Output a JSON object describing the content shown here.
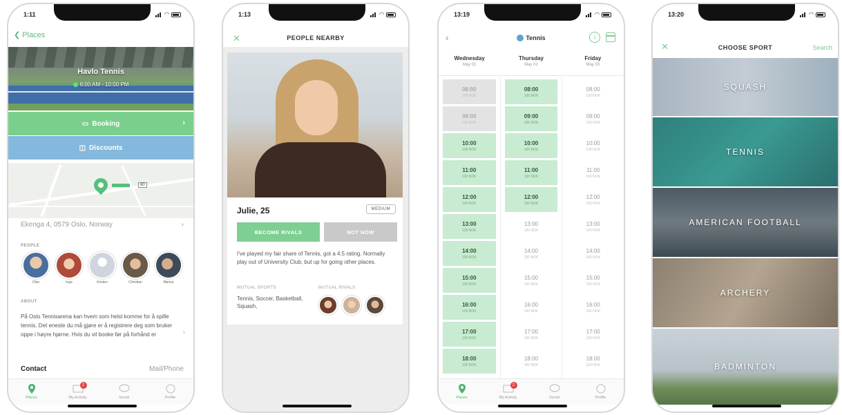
{
  "status_times": [
    "1:11",
    "1:13",
    "13:19",
    "13:20"
  ],
  "phone1": {
    "back_label": "Places",
    "venue_name": "Havlo Tennis",
    "hours": "6:00 AM - 10:00 PM",
    "booking_label": "Booking",
    "discounts_label": "Discounts",
    "address": "Ekenga 4, 0579 Oslo, Norway",
    "people_label": "PEOPLE",
    "people": [
      {
        "name": "Olav",
        "color": "#4a6e9e"
      },
      {
        "name": "Inge",
        "color": "#b04a3a"
      },
      {
        "name": "Kristen",
        "color": "#cfd4de"
      },
      {
        "name": "Christian",
        "color": "#6a5a4a"
      },
      {
        "name": "Marius",
        "color": "#3d4a5a"
      }
    ],
    "about_label": "ABOUT",
    "about_text": "På Oslo Tennisarena kan hvem som helst komme for å spille tennis. Det eneste du må gjøre er å registrere deg som bruker oppe i høyre hjørne. Hvis du vil booke før på forhånd er",
    "contact_label": "Contact",
    "contact_value": "Mail/Phone"
  },
  "tabs": {
    "places": "Places",
    "activity": "My Activity",
    "social": "Social",
    "profile": "Profile",
    "activity_badge": "2"
  },
  "phone2": {
    "title": "PEOPLE NEARBY",
    "name_age": "Julie, 25",
    "level": "MEDIUM",
    "become_rivals": "BECOME RIVALS",
    "not_now": "NOT NOW",
    "bio": "I've played my fair share of Tennis, got a 4.5 rating. Normally play out of University Club, but up for going other places.",
    "mutual_sports_label": "MUTUAL SPORTS",
    "mutual_sports": "Tennis, Soccer, Basketball, Squash,",
    "mutual_rivals_label": "MUTUAL RIVALS"
  },
  "phone3": {
    "title": "Tennis",
    "days": [
      {
        "name": "Wednesday",
        "date": "May 01"
      },
      {
        "name": "Thursday",
        "date": "May 02"
      },
      {
        "name": "Friday",
        "date": "May 03"
      }
    ],
    "price": "100 NOK",
    "columns": [
      [
        {
          "time": "08:00",
          "state": "booked"
        },
        {
          "time": "09:00",
          "state": "booked"
        },
        {
          "time": "10:00",
          "state": "free"
        },
        {
          "time": "11:00",
          "state": "free"
        },
        {
          "time": "12:00",
          "state": "free"
        },
        {
          "time": "13:00",
          "state": "free"
        },
        {
          "time": "14:00",
          "state": "free"
        },
        {
          "time": "15:00",
          "state": "free"
        },
        {
          "time": "16:00",
          "state": "free"
        },
        {
          "time": "17:00",
          "state": "free"
        },
        {
          "time": "18:00",
          "state": "free"
        }
      ],
      [
        {
          "time": "08:00",
          "state": "free"
        },
        {
          "time": "09:00",
          "state": "free"
        },
        {
          "time": "10:00",
          "state": "free"
        },
        {
          "time": "11:00",
          "state": "free"
        },
        {
          "time": "12:00",
          "state": "free"
        },
        {
          "time": "13:00",
          "state": "plain"
        },
        {
          "time": "14:00",
          "state": "plain"
        },
        {
          "time": "15:00",
          "state": "plain"
        },
        {
          "time": "16:00",
          "state": "plain"
        },
        {
          "time": "17:00",
          "state": "plain"
        },
        {
          "time": "18:00",
          "state": "plain"
        }
      ],
      [
        {
          "time": "08:00",
          "state": "plain"
        },
        {
          "time": "09:00",
          "state": "plain"
        },
        {
          "time": "10:00",
          "state": "plain"
        },
        {
          "time": "11:00",
          "state": "plain"
        },
        {
          "time": "12:00",
          "state": "plain"
        },
        {
          "time": "13:00",
          "state": "plain"
        },
        {
          "time": "14:00",
          "state": "plain"
        },
        {
          "time": "15:00",
          "state": "plain"
        },
        {
          "time": "16:00",
          "state": "plain"
        },
        {
          "time": "17:00",
          "state": "plain"
        },
        {
          "time": "18:00",
          "state": "plain"
        }
      ]
    ]
  },
  "phone4": {
    "title": "CHOOSE SPORT",
    "search": "Search",
    "sports": [
      "SQUASH",
      "TENNIS",
      "AMERICAN FOOTBALL",
      "ARCHERY",
      "BADMINTON"
    ]
  },
  "colors": {
    "green": "#79cf8b",
    "blue": "#84b8dc",
    "accent": "#5fb77e",
    "notification": "#e04545"
  }
}
